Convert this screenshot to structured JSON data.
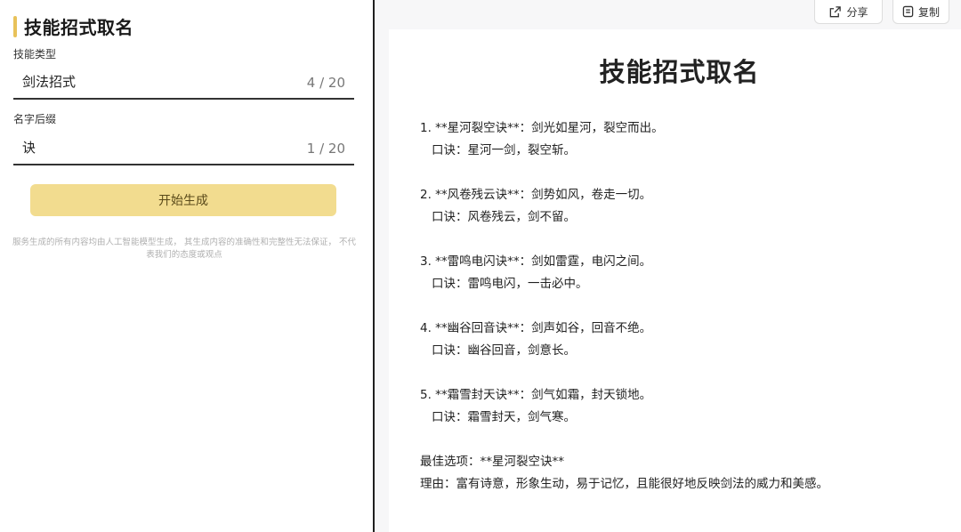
{
  "app": {
    "title": "技能招式取名"
  },
  "form": {
    "skill_type_label": "技能类型",
    "skill_type_value": "剑法招式",
    "skill_type_count": "4 / 20",
    "suffix_label": "名字后缀",
    "suffix_value": "诀",
    "suffix_count": "1 / 20",
    "generate_label": "开始生成",
    "disclaimer": "服务生成的所有内容均由人工智能模型生成， 其生成内容的准确性和完整性无法保证， 不代表我们的态度或观点"
  },
  "toolbar": {
    "share_label": "分享",
    "copy_label": "复制"
  },
  "result": {
    "title": "技能招式取名",
    "items": [
      {
        "line1": "1. **星河裂空诀**：剑光如星河，裂空而出。",
        "line2": "口诀：星河一剑，裂空斩。"
      },
      {
        "line1": "2. **风卷残云诀**：剑势如风，卷走一切。",
        "line2": "口诀：风卷残云，剑不留。"
      },
      {
        "line1": "3. **雷鸣电闪诀**：剑如雷霆，电闪之间。",
        "line2": "口诀：雷鸣电闪，一击必中。"
      },
      {
        "line1": "4. **幽谷回音诀**：剑声如谷，回音不绝。",
        "line2": "口诀：幽谷回音，剑意长。"
      },
      {
        "line1": "5. **霜雪封天诀**：剑气如霜，封天锁地。",
        "line2": "口诀：霜雪封天，剑气寒。"
      }
    ],
    "best": "最佳选项：**星河裂空诀**",
    "reason": "理由：富有诗意，形象生动，易于记忆，且能很好地反映剑法的威力和美感。"
  },
  "colors": {
    "accent": "#e8c25a",
    "button": "#f2dc8f"
  },
  "icons": {
    "share": "share-icon",
    "copy": "copy-icon"
  }
}
